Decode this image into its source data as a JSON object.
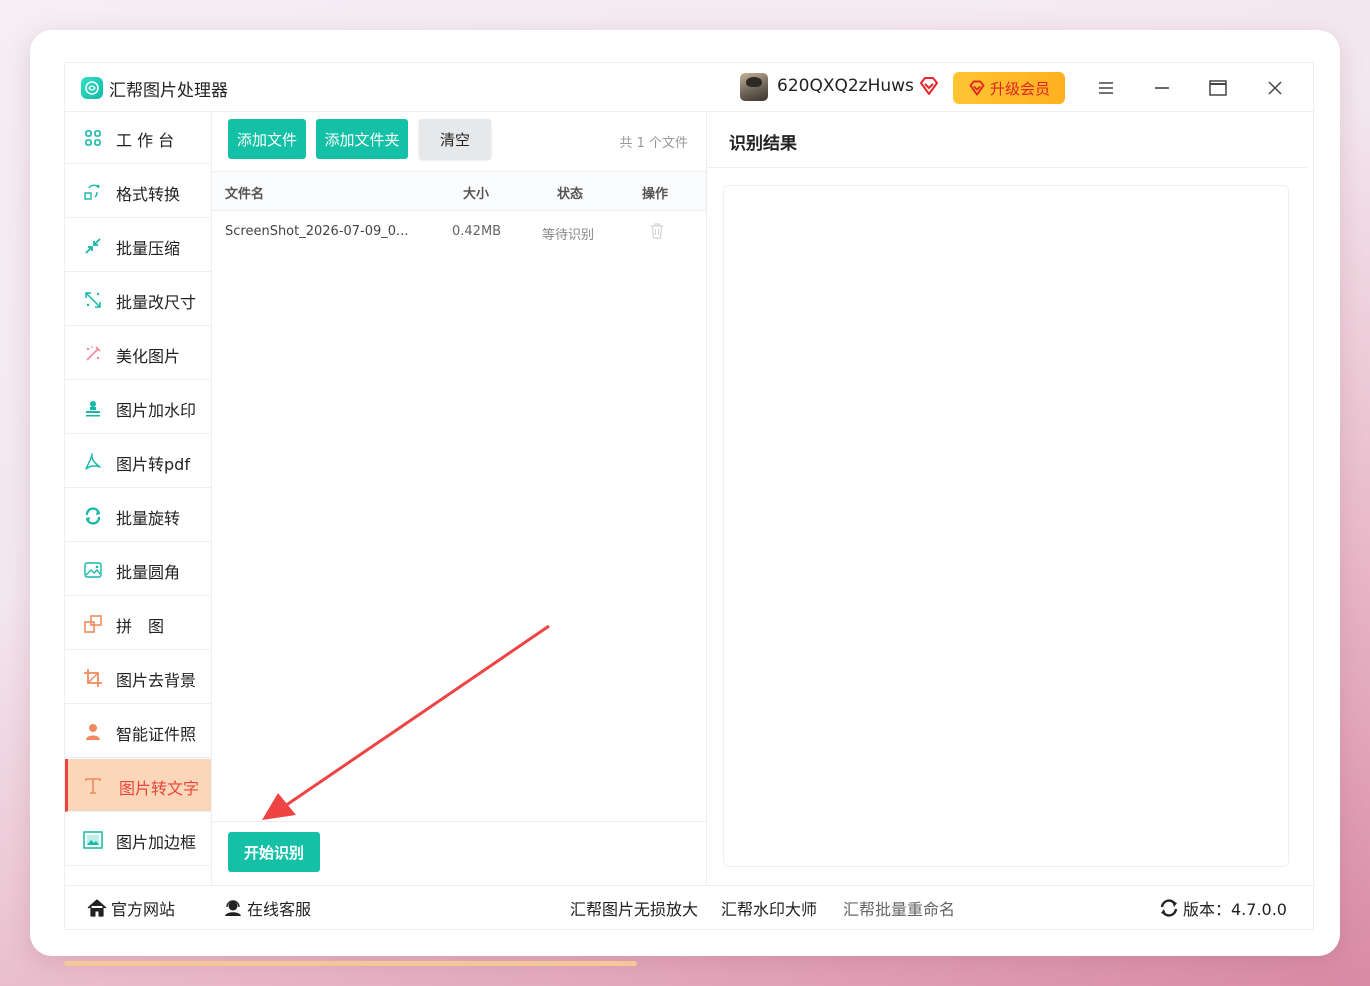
{
  "app": {
    "title": "汇帮图片处理器"
  },
  "user": {
    "name": "620QXQ2zHuws",
    "upgrade_label": "升级会员"
  },
  "colors": {
    "accent": "#14c1a6",
    "active": "#e8453c",
    "upgrade": "#ffb020"
  },
  "sidebar": {
    "items": [
      {
        "label": "工 作 台",
        "icon": "grid-icon"
      },
      {
        "label": "格式转换",
        "icon": "convert-icon"
      },
      {
        "label": "批量压缩",
        "icon": "compress-icon"
      },
      {
        "label": "批量改尺寸",
        "icon": "resize-icon"
      },
      {
        "label": "美化图片",
        "icon": "beautify-icon"
      },
      {
        "label": "图片加水印",
        "icon": "watermark-icon"
      },
      {
        "label": "图片转pdf",
        "icon": "pdf-icon"
      },
      {
        "label": "批量旋转",
        "icon": "rotate-icon"
      },
      {
        "label": "批量圆角",
        "icon": "round-corner-icon"
      },
      {
        "label": "拼　图",
        "icon": "collage-icon"
      },
      {
        "label": "图片去背景",
        "icon": "crop-icon"
      },
      {
        "label": "智能证件照",
        "icon": "person-icon"
      },
      {
        "label": "图片转文字",
        "icon": "text-icon"
      },
      {
        "label": "图片加边框",
        "icon": "frame-icon"
      }
    ]
  },
  "toolbar": {
    "add_file": "添加文件",
    "add_folder": "添加文件夹",
    "clear": "清空",
    "file_count": "共 1 个文件"
  },
  "table": {
    "headers": {
      "name": "文件名",
      "size": "大小",
      "status": "状态",
      "action": "操作"
    },
    "rows": [
      {
        "name": "ScreenShot_2026-07-09_0...",
        "size": "0.42MB",
        "status": "等待识别"
      }
    ]
  },
  "start_button": "开始识别",
  "result": {
    "title": "识别结果"
  },
  "footer": {
    "website": "官方网站",
    "service": "在线客服",
    "link1": "汇帮图片无损放大",
    "link2": "汇帮水印大师",
    "link3": "汇帮批量重命名",
    "version": "版本：4.7.0.0"
  }
}
